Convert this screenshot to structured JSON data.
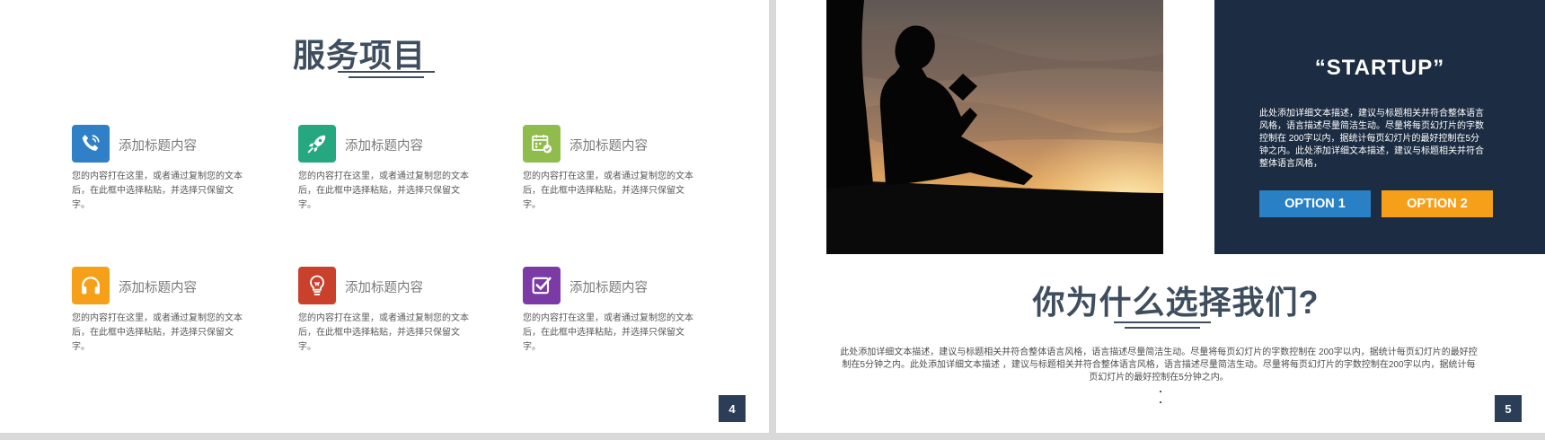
{
  "slide4": {
    "title": "服务项目",
    "items": [
      {
        "title": "添加标题内容",
        "icon": "phone-icon",
        "color": "#2f80c6",
        "desc": "您的内容打在这里，或者通过复制您的文本后，在此框中选择粘贴，并选择只保留文字。"
      },
      {
        "title": "添加标题内容",
        "icon": "rocket-icon",
        "color": "#25a77f",
        "desc": "您的内容打在这里，或者通过复制您的文本后，在此框中选择粘贴，并选择只保留文字。"
      },
      {
        "title": "添加标题内容",
        "icon": "calendar-check-icon",
        "color": "#8fbc4c",
        "desc": "您的内容打在这里，或者通过复制您的文本后，在此框中选择粘贴，并选择只保留文字。"
      },
      {
        "title": "添加标题内容",
        "icon": "headphones-icon",
        "color": "#f6a01a",
        "desc": "您的内容打在这里，或者通过复制您的文本后，在此框中选择粘贴，并选择只保留文字。"
      },
      {
        "title": "添加标题内容",
        "icon": "lightbulb-icon",
        "color": "#c9402b",
        "desc": "您的内容打在这里，或者通过复制您的文本后，在此框中选择粘贴，并选择只保留文字。"
      },
      {
        "title": "添加标题内容",
        "icon": "checkbox-icon",
        "color": "#7b3aa6",
        "desc": "您的内容打在这里，或者通过复制您的文本后，在此框中选择粘贴，并选择只保留文字。"
      }
    ],
    "page_number": "4"
  },
  "slide5": {
    "startup_title": "“STARTUP”",
    "startup_desc": "此处添加详细文本描述，建议与标题相关并符合整体语言风格，语言描述尽量简洁生动。尽量将每页幻灯片的字数控制在 200字以内，据统计每页幻灯片的最好控制在5分钟之内。此处添加详细文本描述，建议与标题相关并符合整体语言风格，",
    "option1": "OPTION 1",
    "option2": "OPTION 2",
    "title": "你为什么选择我们?",
    "desc": "此处添加详细文本描述，建议与标题相关并符合整体语言风格，语言描述尽量简洁生动。尽量将每页幻灯片的字数控制在 200字以内，据统计每页幻灯片的最好控制在5分钟之内。此处添加详细文本描述 ，建议与标题相关并符合整体语言风格，语言描述尽量简洁生动。尽量将每页幻灯片的字数控制在200字以内，据统计每页幻灯片的最好控制在5分钟之内。",
    "page_number": "5",
    "colors": {
      "panel": "#1c2c42",
      "option1": "#2a80c4",
      "option2": "#f6a01a"
    }
  }
}
